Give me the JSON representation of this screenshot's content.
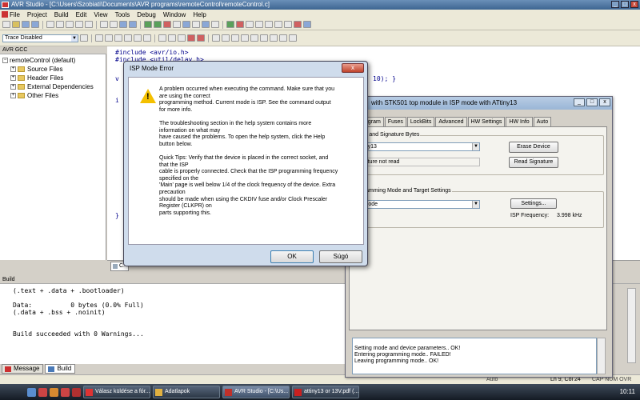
{
  "app": {
    "title": "AVR Studio - [C:\\Users\\Szobiati\\Documents\\AVR programs\\remoteControl\\remoteControl.c]"
  },
  "menu": [
    "File",
    "Project",
    "Build",
    "Edit",
    "View",
    "Tools",
    "Debug",
    "Window",
    "Help"
  ],
  "toolbar": {
    "trace_combo": "Trace Disabled"
  },
  "left_panel": {
    "header": "AVR GCC",
    "root": "remoteControl (default)",
    "items": [
      "Source Files",
      "Header Files",
      "External Dependencies",
      "Other Files"
    ]
  },
  "editor": {
    "lines": [
      "#include <avr/io.h>",
      "#include <util/delay.h>"
    ],
    "visible_fragment": "10); }",
    "tab_label": "C:"
  },
  "build": {
    "header": "Build",
    "lines": [
      "(.text + .data + .bootloader)",
      "",
      "Data:          0 bytes (0.0% Full)",
      "(.data + .bss + .noinit)",
      "",
      "",
      "Build succeeded with 0 Warnings..."
    ],
    "tabs": [
      "Message",
      "Build"
    ]
  },
  "status_bar": {
    "mode": "Auto",
    "position": "Ln 9, Col 24",
    "flags": "CAP  NUM  OVR"
  },
  "stk_window": {
    "title": "with STK501 top module in ISP mode with ATtiny13",
    "tabs": [
      "",
      "Program",
      "Fuses",
      "LockBits",
      "Advanced",
      "HW Settings",
      "HW Info",
      "Auto"
    ],
    "device_group": "vice and Signature Bytes",
    "device_value": "Ttiny13",
    "signature_text": "gnature not read",
    "erase_button": "Erase Device",
    "read_sig_button": "Read Signature",
    "prog_group": "ogramming Mode and Target Settings",
    "prog_mode_value": "P mode",
    "settings_button": "Settings...",
    "isp_freq_label": "ISP Frequency:",
    "isp_freq_value": "3.998 kHz",
    "log": [
      "Setting mode and device parameters.. OK!",
      "Entering programming mode.. FAILED!",
      "Leaving programming mode.. OK!"
    ]
  },
  "dialog": {
    "title": "ISP Mode Error",
    "close": "x",
    "message": "A problem occurred when executing the command. Make sure that you\nare using the correct\nprogramming method. Current mode is ISP. See the command output\nfor more info.\n\nThe troubleshooting section in the help system contains more\ninformation on what may\nhave caused the problems. To open the help system, click the Help\nbutton below.\n\nQuick Tips: Verify that the device is placed in the correct socket, and\nthat the ISP\ncable is properly connected. Check that the ISP programming frequency\nspecified on the\n'Main' page is well below 1/4 of the clock frequency of the device. Extra\nprecaution\nshould be made when using the CKDIV fuse and/or Clock Prescaler\nRegister (CLKPR) on\nparts supporting this.",
    "ok_button": "OK",
    "help_button": "Súgó"
  },
  "taskbar": {
    "tasks": [
      "Válasz küldése a fór...",
      "Adatlapok",
      "AVR Studio - [C:\\Us...",
      "attiny13 or 13V.pdf (..."
    ],
    "clock": "10:11"
  }
}
